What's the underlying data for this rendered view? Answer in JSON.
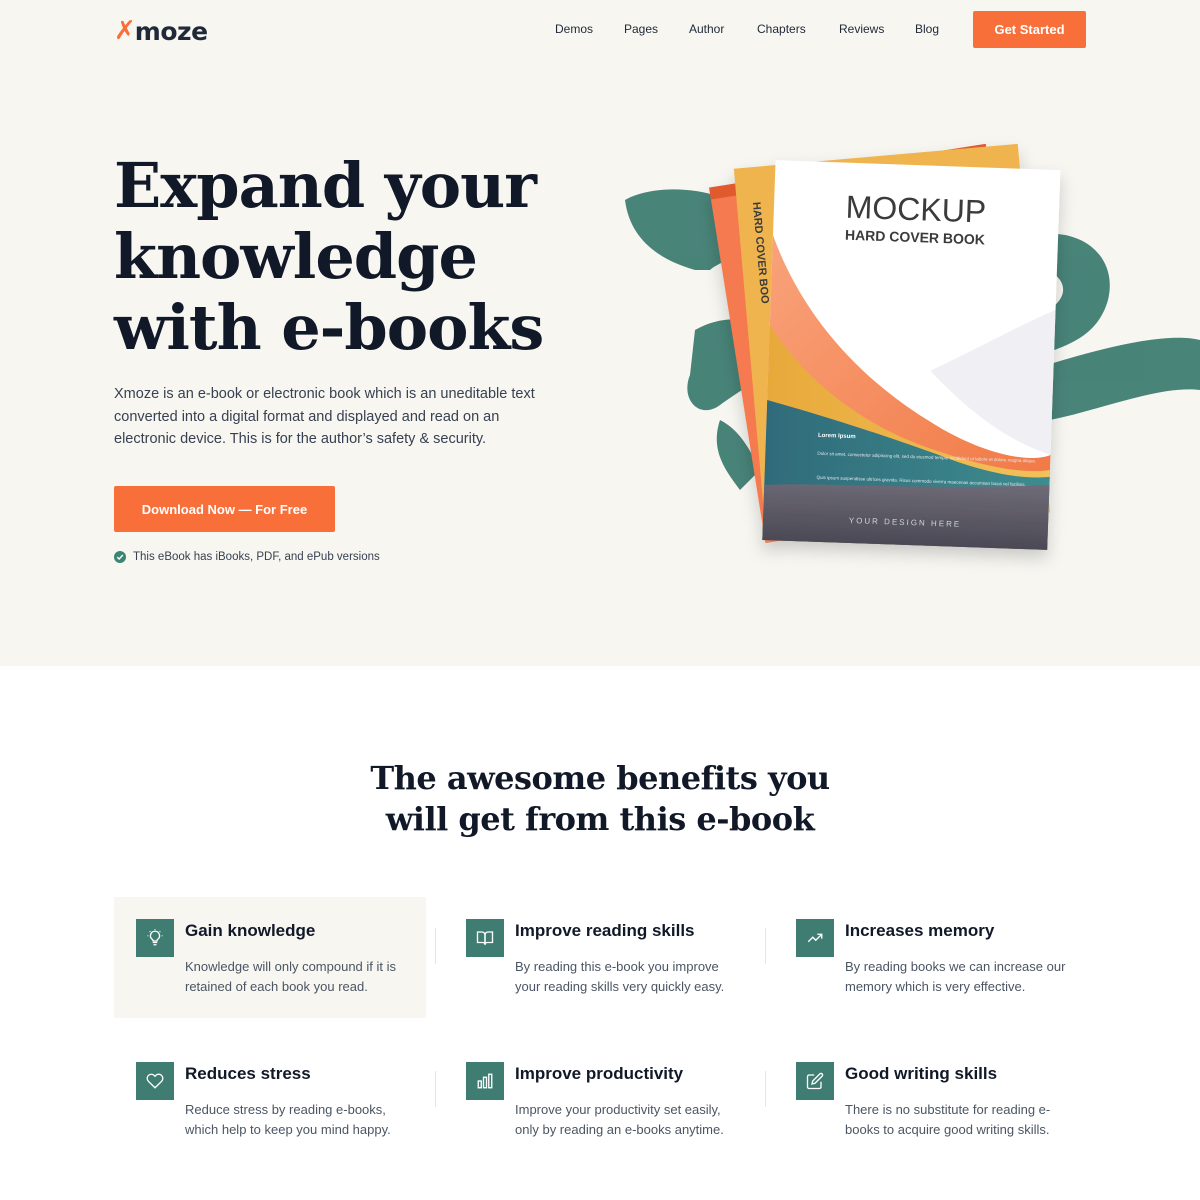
{
  "brand": {
    "mark": "✗",
    "name": "moze",
    "accent": "#f86f3a",
    "teal": "#3f7d72"
  },
  "nav": {
    "links": [
      "Demos",
      "Pages",
      "Author",
      "Chapters",
      "Reviews",
      "Blog"
    ],
    "cta": "Get Started"
  },
  "hero": {
    "title_lines": [
      "Expand your",
      "knowledge",
      "with e-books"
    ],
    "description": "Xmoze is an e-book or electronic book which is an uneditable text converted into a digital format and displayed and read on an electronic device. This is for the author’s safety & security.",
    "button": "Download Now — For Free",
    "note": "This eBook has iBooks, PDF, and ePub versions",
    "book": {
      "title": "MOCKUP",
      "subtitle": "HARD COVER BOOK",
      "spine": "HARD COVER BOOK",
      "lorem_heading": "Lorem Ipsum",
      "lorem_1": "Dolor sit amet, consectetur adipiscing elit, sed do eiusmod tempor incididunt ut labore et dolore magna aliqua.",
      "lorem_2": "Quis ipsum suspendisse ultrices gravida. Risus commodo viverra maecenas accumsan lacus vel facilisis.",
      "footer": "YOUR DESIGN HERE"
    }
  },
  "benefits": {
    "title_lines": [
      "The awesome benefits you",
      "will get from this e-book"
    ],
    "items": [
      {
        "icon": "lightbulb-icon",
        "title": "Gain knowledge",
        "text": "Knowledge will only compound if it is retained of each book you read."
      },
      {
        "icon": "book-open-icon",
        "title": "Improve reading skills",
        "text": "By reading this e-book you improve your reading skills very quickly easy."
      },
      {
        "icon": "trending-up-icon",
        "title": "Increases memory",
        "text": "By reading books we can increase our memory which is very effective."
      },
      {
        "icon": "heart-icon",
        "title": "Reduces stress",
        "text": "Reduce stress by reading e-books, which help to keep you mind  happy."
      },
      {
        "icon": "bar-chart-icon",
        "title": "Improve productivity",
        "text": "Improve your productivity set easily, only by reading an e-books anytime."
      },
      {
        "icon": "edit-icon",
        "title": "Good writing skills",
        "text": "There is no substitute for reading e-books to acquire good writing skills."
      }
    ]
  }
}
